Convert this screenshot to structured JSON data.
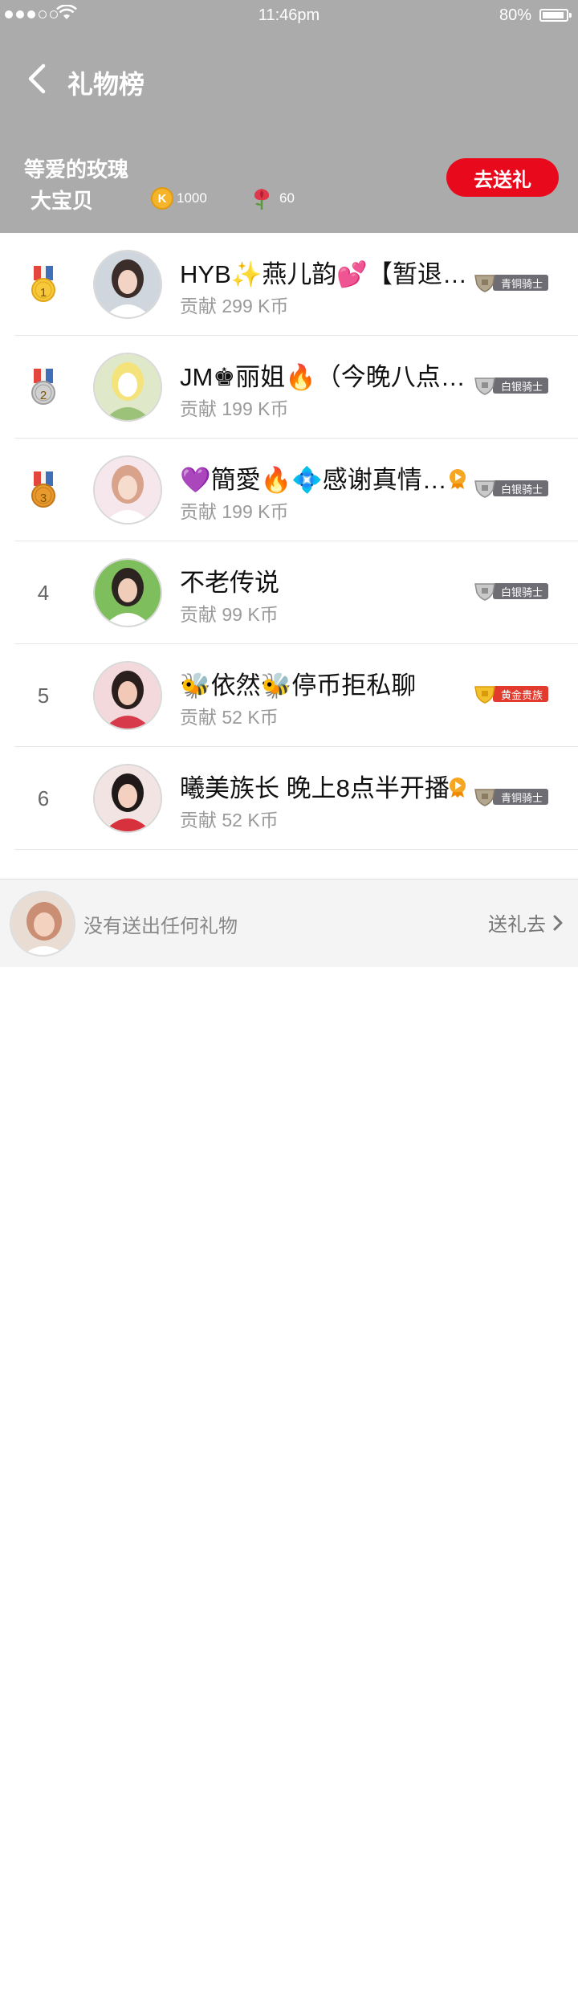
{
  "status_bar": {
    "time": "11:46pm",
    "battery": "80%"
  },
  "nav": {
    "title": "礼物榜",
    "back_icon": "chevron-left-icon"
  },
  "owner": {
    "name": "等爱的玫瑰",
    "subtitle": "大宝贝",
    "coin_icon_letter": "K",
    "coins": "1000",
    "roses": "60",
    "send_button": "去送礼"
  },
  "colors": {
    "header_bg": "#ababab",
    "accent_red": "#e8091c",
    "bronze_badge": "#6d6d73",
    "silver_badge": "#6d6d73",
    "gold_badge": "#e23a2c"
  },
  "list": [
    {
      "rank": "1",
      "medal": "gold",
      "name": "HYB✨燕儿韵💕【暂退江湖】",
      "contribution": "贡献 299 K币",
      "live": false,
      "badge": "青铜骑士",
      "badge_tier": "bronze"
    },
    {
      "rank": "2",
      "medal": "silver",
      "name": "JM♚丽姐🔥（今晚八点开播）",
      "contribution": "贡献 199 K币",
      "live": false,
      "badge": "白银骑士",
      "badge_tier": "silver"
    },
    {
      "rank": "3",
      "medal": "bronze",
      "name": "💜簡愛🔥💠感谢真情陪伴",
      "contribution": "贡献 199 K币",
      "live": true,
      "badge": "白银骑士",
      "badge_tier": "silver"
    },
    {
      "rank": "4",
      "medal": "",
      "name": "不老传说",
      "contribution": "贡献 99 K币",
      "live": false,
      "badge": "白银骑士",
      "badge_tier": "silver"
    },
    {
      "rank": "5",
      "medal": "",
      "name": "🐝依然🐝停币拒私聊",
      "contribution": "贡献 52 K币",
      "live": false,
      "badge": "黄金贵族",
      "badge_tier": "gold"
    },
    {
      "rank": "6",
      "medal": "",
      "name": "曦美族长 晚上8点半开播",
      "contribution": "贡献 52 K币",
      "live": true,
      "badge": "青铜骑士",
      "badge_tier": "bronze"
    }
  ],
  "bottom": {
    "text": "没有送出任何礼物",
    "action": "送礼去"
  }
}
